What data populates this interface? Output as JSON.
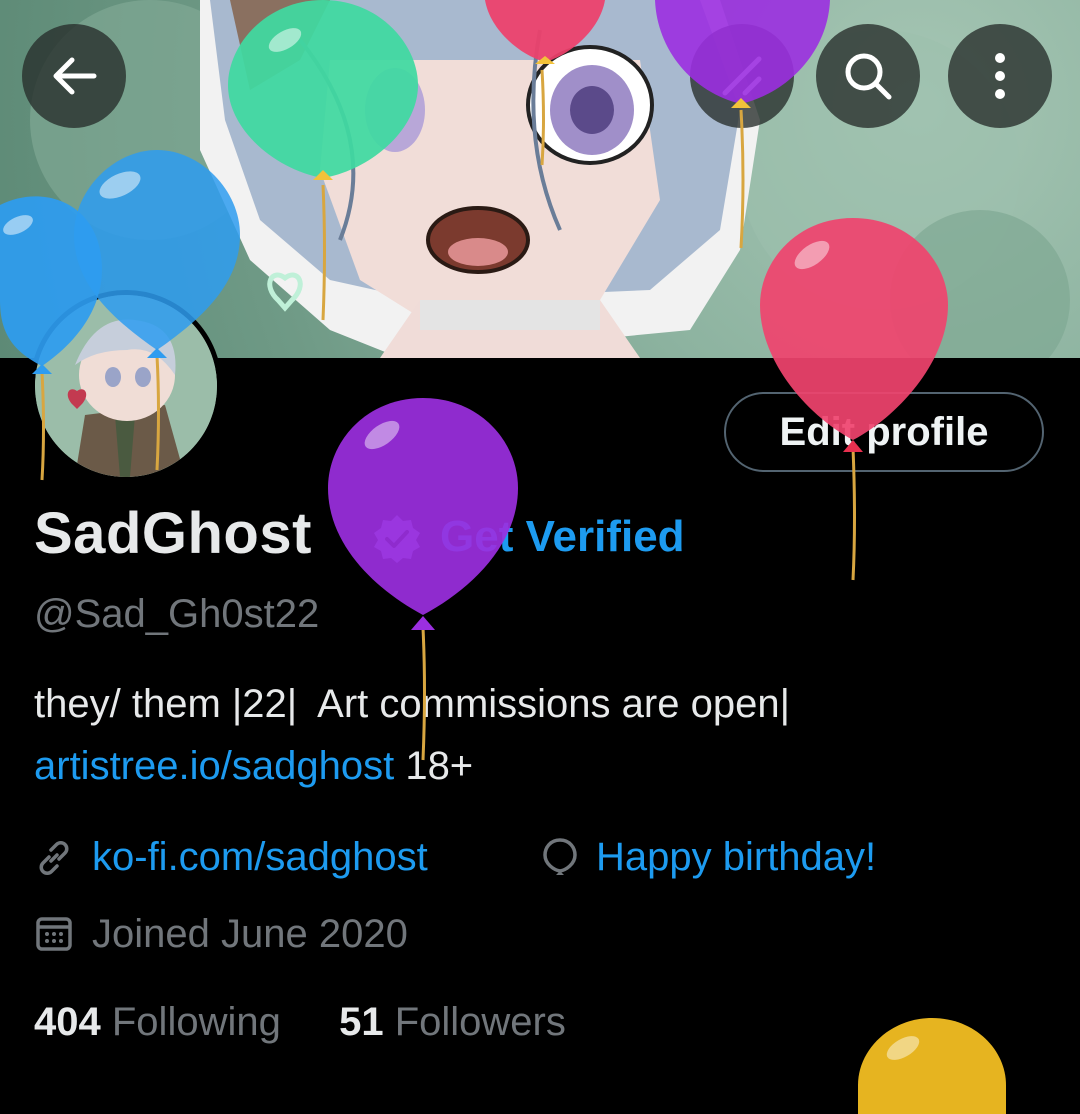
{
  "header": {
    "back_icon": "arrow-left-icon",
    "search_icon": "search-icon",
    "more_icon": "more-vertical-icon"
  },
  "profile": {
    "name": "SadGhost",
    "get_verified_label": "Get Verified",
    "handle": "@Sad_Gh0st22",
    "edit_button_label": "Edit profile",
    "bio_line1": "they/ them |22|  Art commissions are open|",
    "bio_link": "artistree.io/sadghost",
    "bio_suffix": " 18+",
    "website": "ko-fi.com/sadghost",
    "birthday_label": "Happy birthday!",
    "joined": "Joined June 2020",
    "following_count": "404",
    "following_label": "Following",
    "followers_count": "51",
    "followers_label": "Followers"
  },
  "colors": {
    "background": "#000000",
    "accent": "#1d9bf0",
    "muted_text": "#71767b",
    "primary_text": "#e7e9ea",
    "button_border": "#536471"
  }
}
